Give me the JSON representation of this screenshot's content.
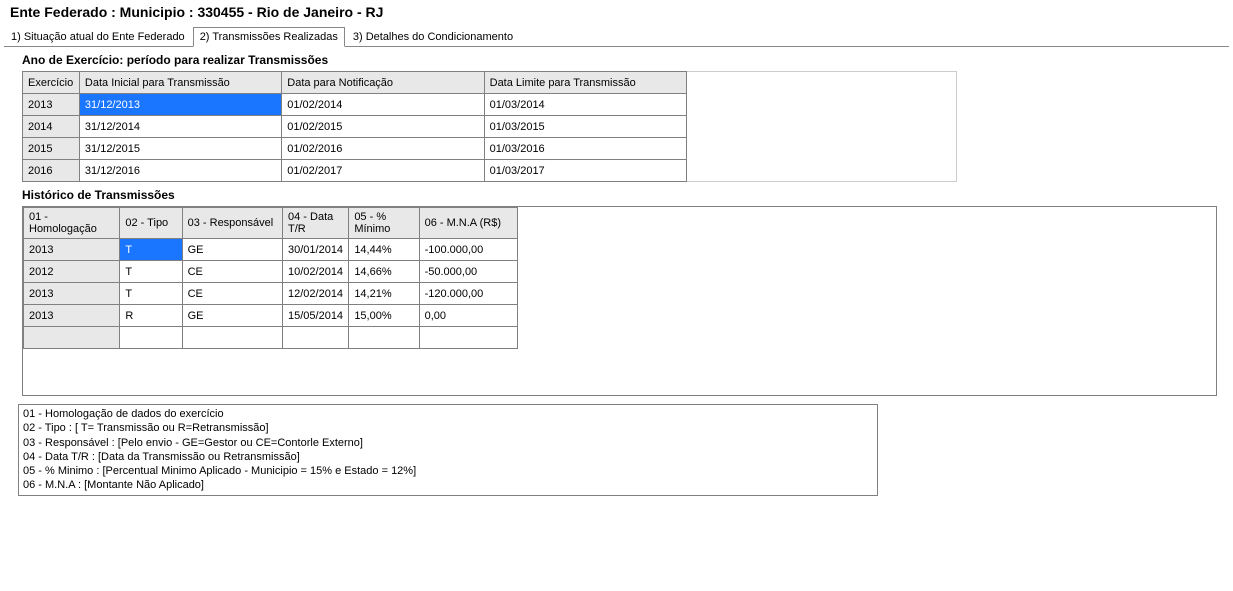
{
  "page_title": "Ente Federado : Municipio : 330455 - Rio de Janeiro - RJ",
  "tabs": {
    "t1": "1) Situação atual do Ente Federado",
    "t2": "2) Transmissões Realizadas",
    "t3": "3) Detalhes do Condicionamento"
  },
  "section1_title": "Ano de Exercício: período para realizar Transmissões",
  "table1": {
    "headers": [
      "Exercício",
      "Data Inicial para Transmissão",
      "Data  para Notificação",
      "Data Limite para Transmissão"
    ],
    "rows": [
      {
        "exercicio": "2013",
        "ini": "31/12/2013",
        "notif": "01/02/2014",
        "lim": "01/03/2014",
        "sel": true
      },
      {
        "exercicio": "2014",
        "ini": "31/12/2014",
        "notif": "01/02/2015",
        "lim": "01/03/2015",
        "sel": false
      },
      {
        "exercicio": "2015",
        "ini": "31/12/2015",
        "notif": "01/02/2016",
        "lim": "01/03/2016",
        "sel": false
      },
      {
        "exercicio": "2016",
        "ini": "31/12/2016",
        "notif": "01/02/2017",
        "lim": "01/03/2017",
        "sel": false
      }
    ]
  },
  "section2_title": "Histórico de Transmissões",
  "table2": {
    "headers": [
      "01 - Homologação",
      "02 - Tipo",
      "03 - Responsável",
      "04 - Data T/R",
      "05 - % Mínimo",
      "06 - M.N.A (R$)"
    ],
    "rows": [
      {
        "c1": "2013",
        "c2": "T",
        "c3": "GE",
        "c4": "30/01/2014",
        "c5": "14,44%",
        "c6": "-100.000,00",
        "sel": true
      },
      {
        "c1": "2012",
        "c2": "T",
        "c3": "CE",
        "c4": "10/02/2014",
        "c5": "14,66%",
        "c6": "-50.000,00",
        "sel": false
      },
      {
        "c1": "2013",
        "c2": "T",
        "c3": "CE",
        "c4": "12/02/2014",
        "c5": "14,21%",
        "c6": "-120.000,00",
        "sel": false
      },
      {
        "c1": "2013",
        "c2": "R",
        "c3": "GE",
        "c4": "15/05/2014",
        "c5": "15,00%",
        "c6": "0,00",
        "sel": false
      },
      {
        "c1": "",
        "c2": "",
        "c3": "",
        "c4": "",
        "c5": "",
        "c6": "",
        "sel": false
      }
    ]
  },
  "legend": {
    "l1": "01 - Homologação de dados do exercício",
    "l2": "02 - Tipo : [ T= Transmissão ou R=Retransmissão]",
    "l3": "03 - Responsável : [Pelo envio - GE=Gestor ou CE=Contorle Externo]",
    "l4": "04 - Data T/R : [Data da Transmissão ou Retransmissão]",
    "l5": "05 - % Minimo : [Percentual Minimo Aplicado - Municipio = 15% e Estado = 12%]",
    "l6": "06 - M.N.A : [Montante Não Aplicado]"
  }
}
